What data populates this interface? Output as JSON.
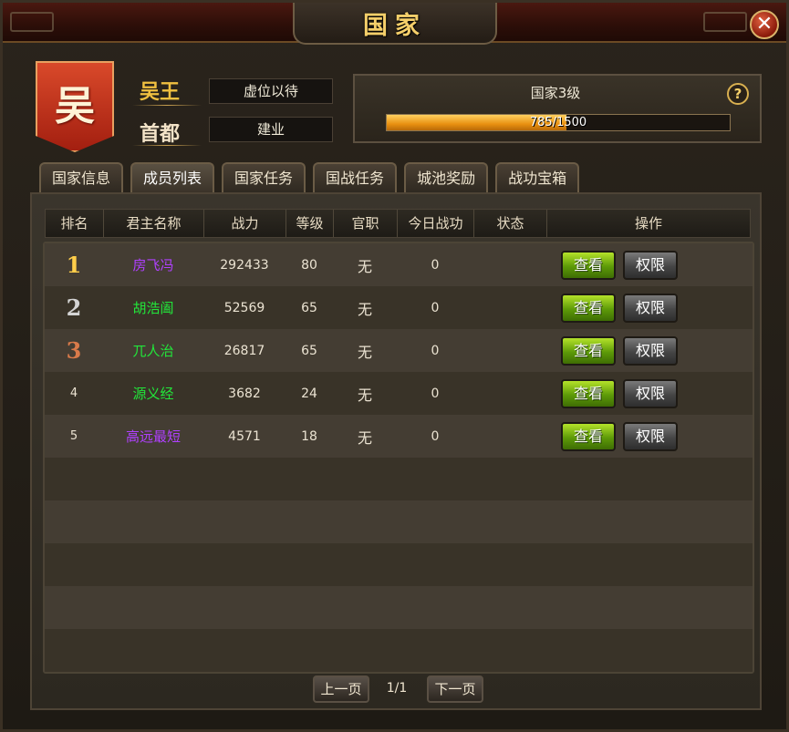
{
  "window": {
    "title": "国家",
    "close_glyph": "✕"
  },
  "country": {
    "emblem_char": "吴",
    "king_label": "吴王",
    "king_value": "虚位以待",
    "capital_label": "首都",
    "capital_value": "建业",
    "level_text": "国家3级",
    "progress_text": "785/1500",
    "progress_fraction": 0.523,
    "help_glyph": "?"
  },
  "tabs": [
    {
      "label": "国家信息",
      "active": false
    },
    {
      "label": "成员列表",
      "active": true
    },
    {
      "label": "国家任务",
      "active": false
    },
    {
      "label": "国战任务",
      "active": false
    },
    {
      "label": "城池奖励",
      "active": false
    },
    {
      "label": "战功宝箱",
      "active": false
    }
  ],
  "table": {
    "headers": [
      "排名",
      "君主名称",
      "战力",
      "等级",
      "官职",
      "今日战功",
      "状态",
      "操作"
    ],
    "rows": [
      {
        "rank": "1",
        "name": "房飞冯",
        "power": "292433",
        "level": "80",
        "title": "无",
        "merit": "0",
        "status": "",
        "name_color": "#b040ff",
        "rank_color": "#ffce4a"
      },
      {
        "rank": "2",
        "name": "胡浩阖",
        "power": "52569",
        "level": "65",
        "title": "无",
        "merit": "0",
        "status": "",
        "name_color": "#22e63a",
        "rank_color": "#d4d4d4"
      },
      {
        "rank": "3",
        "name": "兀人治",
        "power": "26817",
        "level": "65",
        "title": "无",
        "merit": "0",
        "status": "",
        "name_color": "#22e63a",
        "rank_color": "#d97a4a"
      },
      {
        "rank": "4",
        "name": "源义经",
        "power": "3682",
        "level": "24",
        "title": "无",
        "merit": "0",
        "status": "",
        "name_color": "#22e63a",
        "rank_color": "#ebe3d2"
      },
      {
        "rank": "5",
        "name": "高远最短",
        "power": "4571",
        "level": "18",
        "title": "无",
        "merit": "0",
        "status": "",
        "name_color": "#b040ff",
        "rank_color": "#ebe3d2"
      }
    ],
    "view_label": "查看",
    "perm_label": "权限"
  },
  "pager": {
    "prev_label": "上一页",
    "next_label": "下一页",
    "page_text": "1/1"
  }
}
